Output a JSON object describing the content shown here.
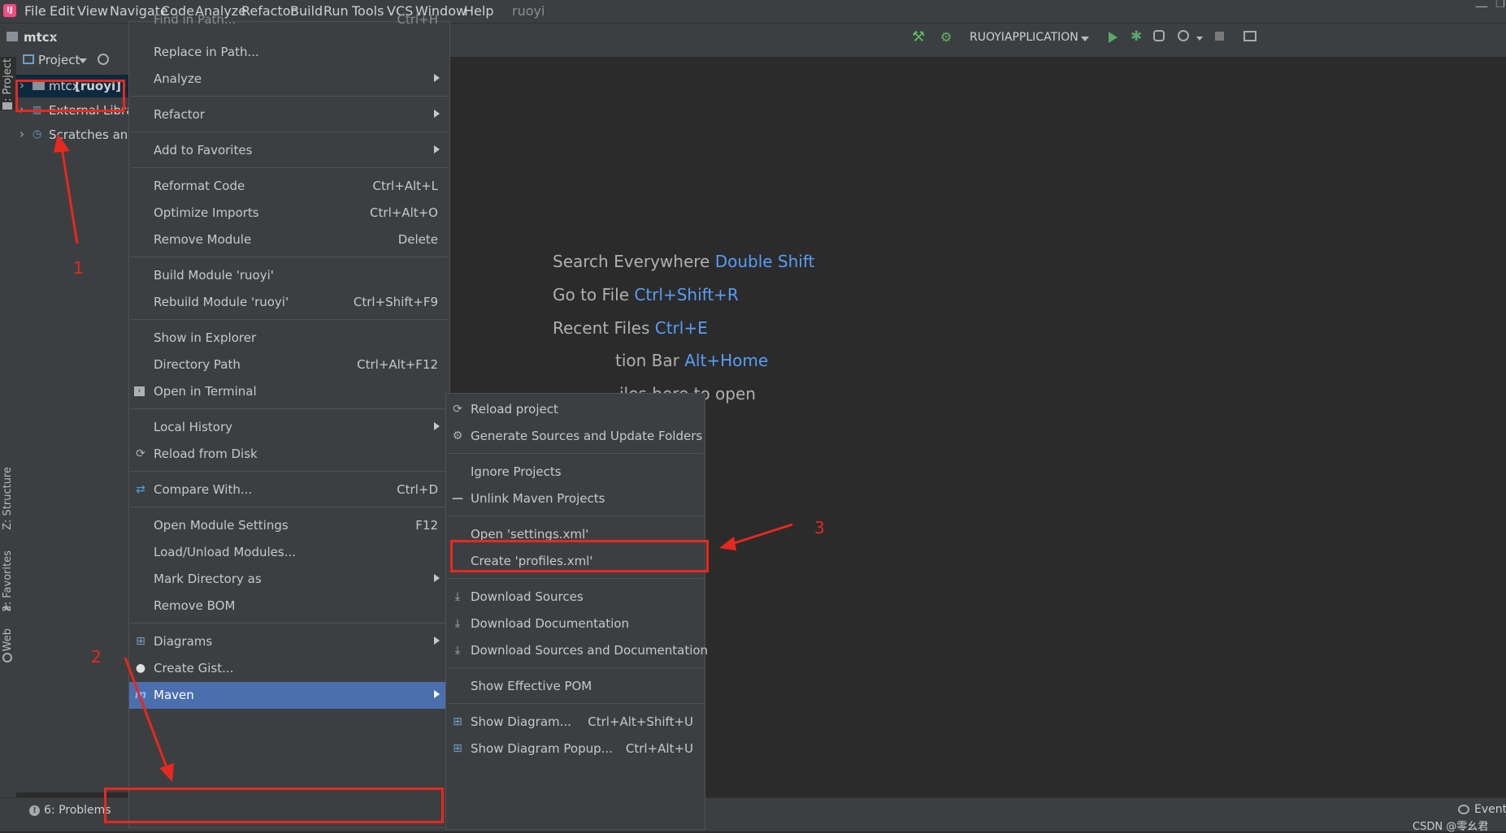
{
  "menubar": {
    "items": [
      "File",
      "Edit",
      "View",
      "Navigate",
      "Code",
      "Analyze",
      "Refactor",
      "Build",
      "Run",
      "Tools",
      "VCS",
      "Window",
      "Help"
    ],
    "project_name": "ruoyi"
  },
  "navbar": {
    "breadcrumb": "mtcx",
    "run_config": "RUOYIAPPLICATION"
  },
  "left_strip": {
    "project_tab": "1: Project",
    "structure_tab": "Z: Structure",
    "favorites_tab": "2: Favorites",
    "web_tab": "Web"
  },
  "project_panel": {
    "header": "Project",
    "tree": [
      {
        "label": "mtcx",
        "module": "[ruoyi]"
      },
      {
        "label": "External Libra"
      },
      {
        "label": "Scratches and"
      }
    ]
  },
  "editor": {
    "hints": [
      {
        "text": "Search Everywhere",
        "key": "Double Shift"
      },
      {
        "text": "Go to File",
        "key": "Ctrl+Shift+R"
      },
      {
        "text": "Recent Files",
        "key": "Ctrl+E"
      },
      {
        "text": "tion Bar",
        "key": "Alt+Home"
      },
      {
        "text": "iles here to open",
        "key": ""
      }
    ]
  },
  "context_menu": {
    "top_partial": {
      "label": "Find in Path...",
      "shortcut": "Ctrl+H"
    },
    "groups": [
      [
        {
          "label": "Replace in Path...",
          "shortcut": ""
        },
        {
          "label": "Analyze",
          "submenu": true
        }
      ],
      [
        {
          "label": "Refactor",
          "submenu": true
        }
      ],
      [
        {
          "label": "Add to Favorites",
          "submenu": true
        }
      ],
      [
        {
          "label": "Reformat Code",
          "shortcut": "Ctrl+Alt+L"
        },
        {
          "label": "Optimize Imports",
          "shortcut": "Ctrl+Alt+O"
        },
        {
          "label": "Remove Module",
          "shortcut": "Delete"
        }
      ],
      [
        {
          "label": "Build Module 'ruoyi'",
          "shortcut": ""
        },
        {
          "label": "Rebuild Module 'ruoyi'",
          "shortcut": "Ctrl+Shift+F9"
        }
      ],
      [
        {
          "label": "Show in Explorer",
          "shortcut": ""
        },
        {
          "label": "Directory Path",
          "shortcut": "Ctrl+Alt+F12"
        },
        {
          "label": "Open in Terminal",
          "icon": "terminal-icon"
        }
      ],
      [
        {
          "label": "Local History",
          "submenu": true
        },
        {
          "label": "Reload from Disk",
          "icon": "reload-icon"
        }
      ],
      [
        {
          "label": "Compare With...",
          "shortcut": "Ctrl+D",
          "icon": "compare-icon"
        }
      ],
      [
        {
          "label": "Open Module Settings",
          "shortcut": "F12"
        },
        {
          "label": "Load/Unload Modules..."
        },
        {
          "label": "Mark Directory as",
          "submenu": true
        },
        {
          "label": "Remove BOM"
        }
      ],
      [
        {
          "label": "Diagrams",
          "submenu": true,
          "icon": "diagram-icon"
        },
        {
          "label": "Create Gist...",
          "icon": "github-icon"
        },
        {
          "label": "Maven",
          "submenu": true,
          "icon": "maven-icon",
          "selected": true
        }
      ]
    ]
  },
  "maven_submenu": {
    "groups": [
      [
        {
          "label": "Reload project",
          "icon": "reload-icon"
        },
        {
          "label": "Generate Sources and Update Folders",
          "icon": "generate-icon"
        }
      ],
      [
        {
          "label": "Ignore Projects"
        },
        {
          "label": "Unlink Maven Projects",
          "icon": "minus-icon"
        }
      ],
      [
        {
          "label": "Open 'settings.xml'"
        },
        {
          "label": "Create 'profiles.xml'"
        }
      ],
      [
        {
          "label": "Download Sources",
          "icon": "download-icon"
        },
        {
          "label": "Download Documentation",
          "icon": "download-icon"
        },
        {
          "label": "Download Sources and Documentation",
          "icon": "download-icon"
        }
      ],
      [
        {
          "label": "Show Effective POM"
        }
      ],
      [
        {
          "label": "Show Diagram...",
          "shortcut": "Ctrl+Alt+Shift+U",
          "icon": "diagram-icon"
        },
        {
          "label": "Show Diagram Popup...",
          "shortcut": "Ctrl+Alt+U",
          "icon": "diagram-icon"
        }
      ]
    ]
  },
  "statusbar": {
    "problems": "6: Problems",
    "event_log": "Event",
    "watermark": "CSDN @零幺君"
  },
  "annotations": {
    "step1": "1",
    "step2": "2",
    "step3": "3"
  },
  "colors": {
    "accent_selected": "#4b6eaf",
    "annotation_red": "#e8281e",
    "hint_key_blue": "#589df6"
  }
}
